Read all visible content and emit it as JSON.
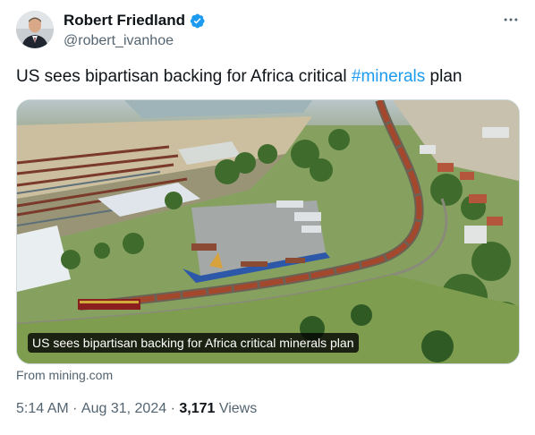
{
  "author": {
    "display_name": "Robert Friedland",
    "handle": "@robert_ivanhoe",
    "verified_color": "#1d9bf0"
  },
  "tweet": {
    "text_before": "US sees bipartisan backing for Africa critical ",
    "hashtag": "#minerals",
    "text_after": " plan"
  },
  "card": {
    "caption": "US sees bipartisan backing for Africa critical minerals plan",
    "source": "From mining.com"
  },
  "meta": {
    "time": "5:14 AM",
    "separator": " · ",
    "date": "Aug 31, 2024",
    "views_count": "3,171",
    "views_label": " Views"
  },
  "icons": {
    "verified": "verified-badge-icon",
    "more": "more-options-icon"
  },
  "colors": {
    "hashtag": "#1d9bf0",
    "secondary_text": "#536471",
    "primary_text": "#0f1419"
  }
}
